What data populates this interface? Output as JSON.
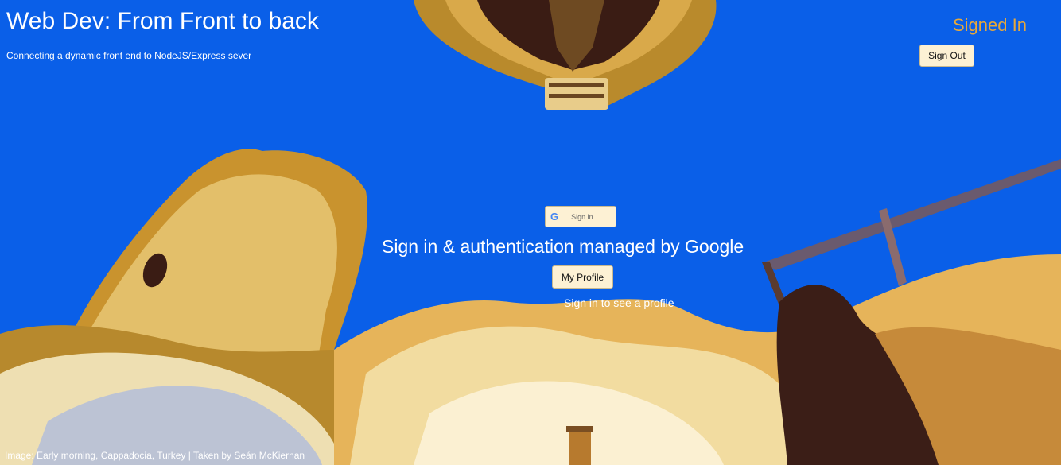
{
  "header": {
    "title": "Web Dev: From Front to back",
    "subtitle": "Connecting a dynamic front end to NodeJS/Express sever"
  },
  "auth": {
    "status": "Signed In",
    "sign_out_label": "Sign Out",
    "google_button_label": "Sign in"
  },
  "main": {
    "headline": "Sign in & authentication managed by Google",
    "profile_button_label": "My Profile",
    "hint": "Sign in to see a profile"
  },
  "footer": {
    "image_caption": "Image: Early morning, Cappadocia, Turkey | Taken by Seán McKiernan"
  },
  "colors": {
    "sky": "#0a5fe8",
    "accent": "#e8a83a",
    "button_bg": "#fdf1d4"
  }
}
